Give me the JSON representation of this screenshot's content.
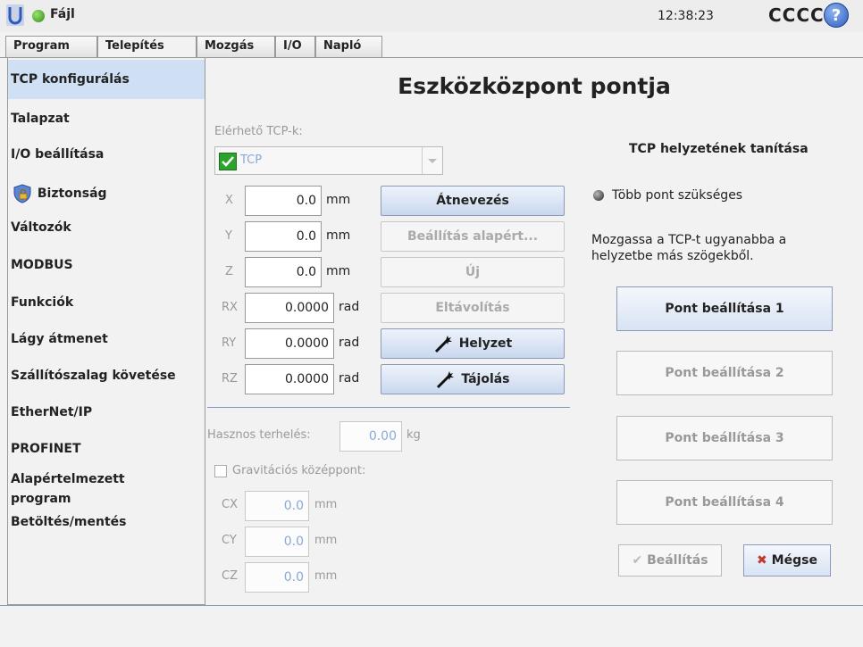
{
  "header": {
    "file_label": "Fájl",
    "clock": "12:38:23",
    "robot_name": "CCCC",
    "help": "?"
  },
  "tabs": [
    {
      "label": "Program"
    },
    {
      "label": "Telepítés"
    },
    {
      "label": "Mozgás"
    },
    {
      "label": "I/O"
    },
    {
      "label": "Napló"
    }
  ],
  "sidebar": {
    "items": [
      {
        "label": "TCP konfigurálás"
      },
      {
        "label": "Talapzat"
      },
      {
        "label": "I/O beállítása"
      },
      {
        "label": "Biztonság"
      },
      {
        "label": "Változók"
      },
      {
        "label": "MODBUS"
      },
      {
        "label": "Funkciók"
      },
      {
        "label": "Lágy átmenet"
      },
      {
        "label": "Szállítószalag követése"
      },
      {
        "label": "EtherNet/IP"
      },
      {
        "label": "PROFINET"
      },
      {
        "label": "Alapértelmezett program"
      },
      {
        "label": "Betöltés/mentés"
      }
    ]
  },
  "main": {
    "title": "Eszközközpont pontja",
    "available_label": "Elérhető TCP-k:",
    "tcp_selected": "TCP",
    "pose": [
      {
        "axis": "X",
        "value": "0.0",
        "unit": "mm"
      },
      {
        "axis": "Y",
        "value": "0.0",
        "unit": "mm"
      },
      {
        "axis": "Z",
        "value": "0.0",
        "unit": "mm"
      },
      {
        "axis": "RX",
        "value": "0.0000",
        "unit": "rad"
      },
      {
        "axis": "RY",
        "value": "0.0000",
        "unit": "rad"
      },
      {
        "axis": "RZ",
        "value": "0.0000",
        "unit": "rad"
      }
    ],
    "buttons": {
      "rename": "Átnevezés",
      "set_default": "Beállítás alapért...",
      "new": "Új",
      "remove": "Eltávolítás",
      "position": "Helyzet",
      "orientation": "Tájolás"
    },
    "payload_label": "Hasznos terhelés:",
    "payload_value": "0.00",
    "payload_unit": "kg",
    "cog_label": "Gravitációs középpont:",
    "cog": [
      {
        "axis": "CX",
        "value": "0.0",
        "unit": "mm"
      },
      {
        "axis": "CY",
        "value": "0.0",
        "unit": "mm"
      },
      {
        "axis": "CZ",
        "value": "0.0",
        "unit": "mm"
      }
    ]
  },
  "teach": {
    "title": "TCP helyzetének tanítása",
    "status": "Több pont szükséges",
    "instruction": "Mozgassa a TCP-t ugyanabba a helyzetbe más szögekből.",
    "points": [
      "Pont beállítása 1",
      "Pont beállítása 2",
      "Pont beállítása 3",
      "Pont beállítása 4"
    ],
    "set_label": "Beállítás",
    "cancel_label": "Mégse"
  }
}
